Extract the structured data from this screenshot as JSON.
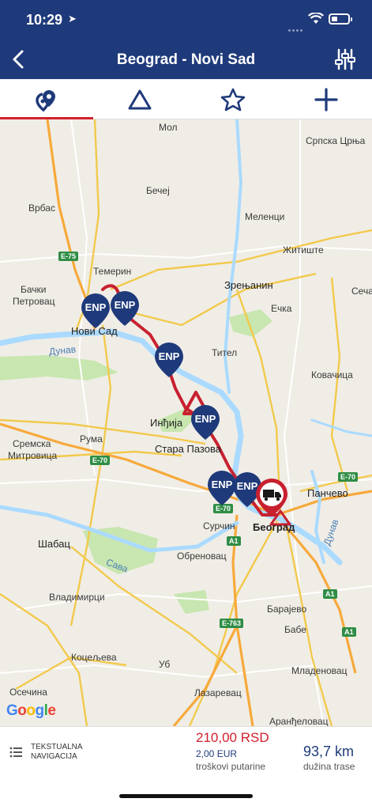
{
  "status": {
    "time": "10:29"
  },
  "header": {
    "title": "Beograd - Novi Sad"
  },
  "tabs": [
    {
      "name": "route-pins",
      "active": true
    },
    {
      "name": "warnings",
      "active": false
    },
    {
      "name": "favorites",
      "active": false
    },
    {
      "name": "add",
      "active": false
    }
  ],
  "map": {
    "places": {
      "mol": "Мол",
      "srpska_crnja": "Српска Црња",
      "becej": "Бечеј",
      "vrbas": "Врбас",
      "melenci": "Меленци",
      "zitiste": "Житиште",
      "temerin": "Темерин",
      "backi_petrovac_1": "Бачки",
      "backi_petrovac_2": "Петровац",
      "zrenjanin": "Зрењанин",
      "secanj": "Сечањ",
      "novi_sad": "Нови Сад",
      "ecka": "Ечка",
      "dunav": "Дунав",
      "titel": "Тител",
      "kovacica": "Ковачица",
      "indjija": "Инђија",
      "sremska_1": "Сремска",
      "sremska_2": "Митровица",
      "ruma": "Рума",
      "stara_pazova": "Стара Пазова",
      "pancevo": "Панчево",
      "surcin": "Сурчин",
      "beograd": "Београд",
      "sabac": "Шабац",
      "sava": "Сава",
      "obrenovac": "Обреновац",
      "vladimirci": "Владимирци",
      "barajevo": "Барајево",
      "babe": "Бабе",
      "koceljeva": "Коцељева",
      "ub": "Уб",
      "mladenovac": "Младеновац",
      "osecina": "Осечина",
      "lazarevac": "Лазаревац",
      "arandjelovac": "Аранђеловац",
      "dunav_east": "Дунав"
    },
    "shields": {
      "e75": "E-75",
      "e70_w": "E-70",
      "e70_m": "E-70",
      "e70_e": "E-70",
      "a1_n": "A1",
      "a1_s": "A1",
      "e763": "E-763",
      "a1_e": "A1"
    },
    "pin_label": "ENP",
    "google_logo": "Google",
    "colors": {
      "route": "#c8202f",
      "pin": "#1f3a7a",
      "water": "#aadaff",
      "park": "#c8e6b0"
    }
  },
  "footer": {
    "text_nav": "TEKSTUALNA NAVIGACIJA",
    "cost_rsd": "210,00 RSD",
    "cost_eur": "2,00 EUR",
    "cost_label": "troškovi putarine",
    "length_value": "93,7 km",
    "length_label": "dužina trase"
  }
}
